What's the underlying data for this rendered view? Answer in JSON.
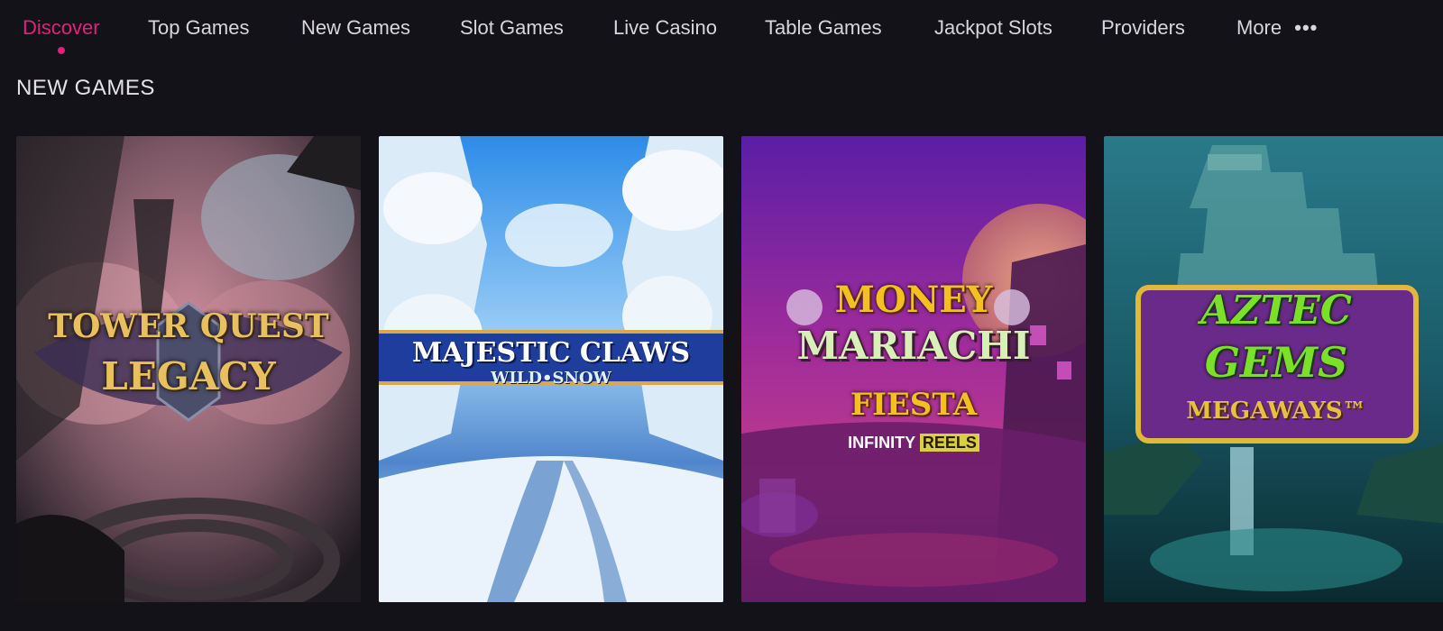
{
  "nav": {
    "items": [
      {
        "label": "Discover",
        "active": true
      },
      {
        "label": "Top Games",
        "active": false
      },
      {
        "label": "New Games",
        "active": false
      },
      {
        "label": "Slot Games",
        "active": false
      },
      {
        "label": "Live Casino",
        "active": false
      },
      {
        "label": "Table Games",
        "active": false
      },
      {
        "label": "Jackpot Slots",
        "active": false
      },
      {
        "label": "Providers",
        "active": false
      }
    ],
    "more_label": "More",
    "more_icon": "•••",
    "accent_color": "#e0227c"
  },
  "section": {
    "title": "NEW GAMES"
  },
  "games": [
    {
      "title_line1": "TOWER QUEST",
      "title_line2": "LEGACY",
      "icon": "tower-quest-legacy-artwork"
    },
    {
      "title_line1": "MAJESTIC CLAWS",
      "title_line2": "WILD•SNOW",
      "icon": "majestic-claws-artwork"
    },
    {
      "title_line1": "MONEY",
      "title_line2": "MARIACHI",
      "title_line3": "FIESTA",
      "title_line4": "INFINITY",
      "title_line5": "REELS",
      "icon": "money-mariachi-fiesta-artwork"
    },
    {
      "title_line1": "AZTEC",
      "title_line2": "GEMS",
      "title_line3": "MEGAWAYS™",
      "icon": "aztec-gems-megaways-artwork"
    }
  ]
}
